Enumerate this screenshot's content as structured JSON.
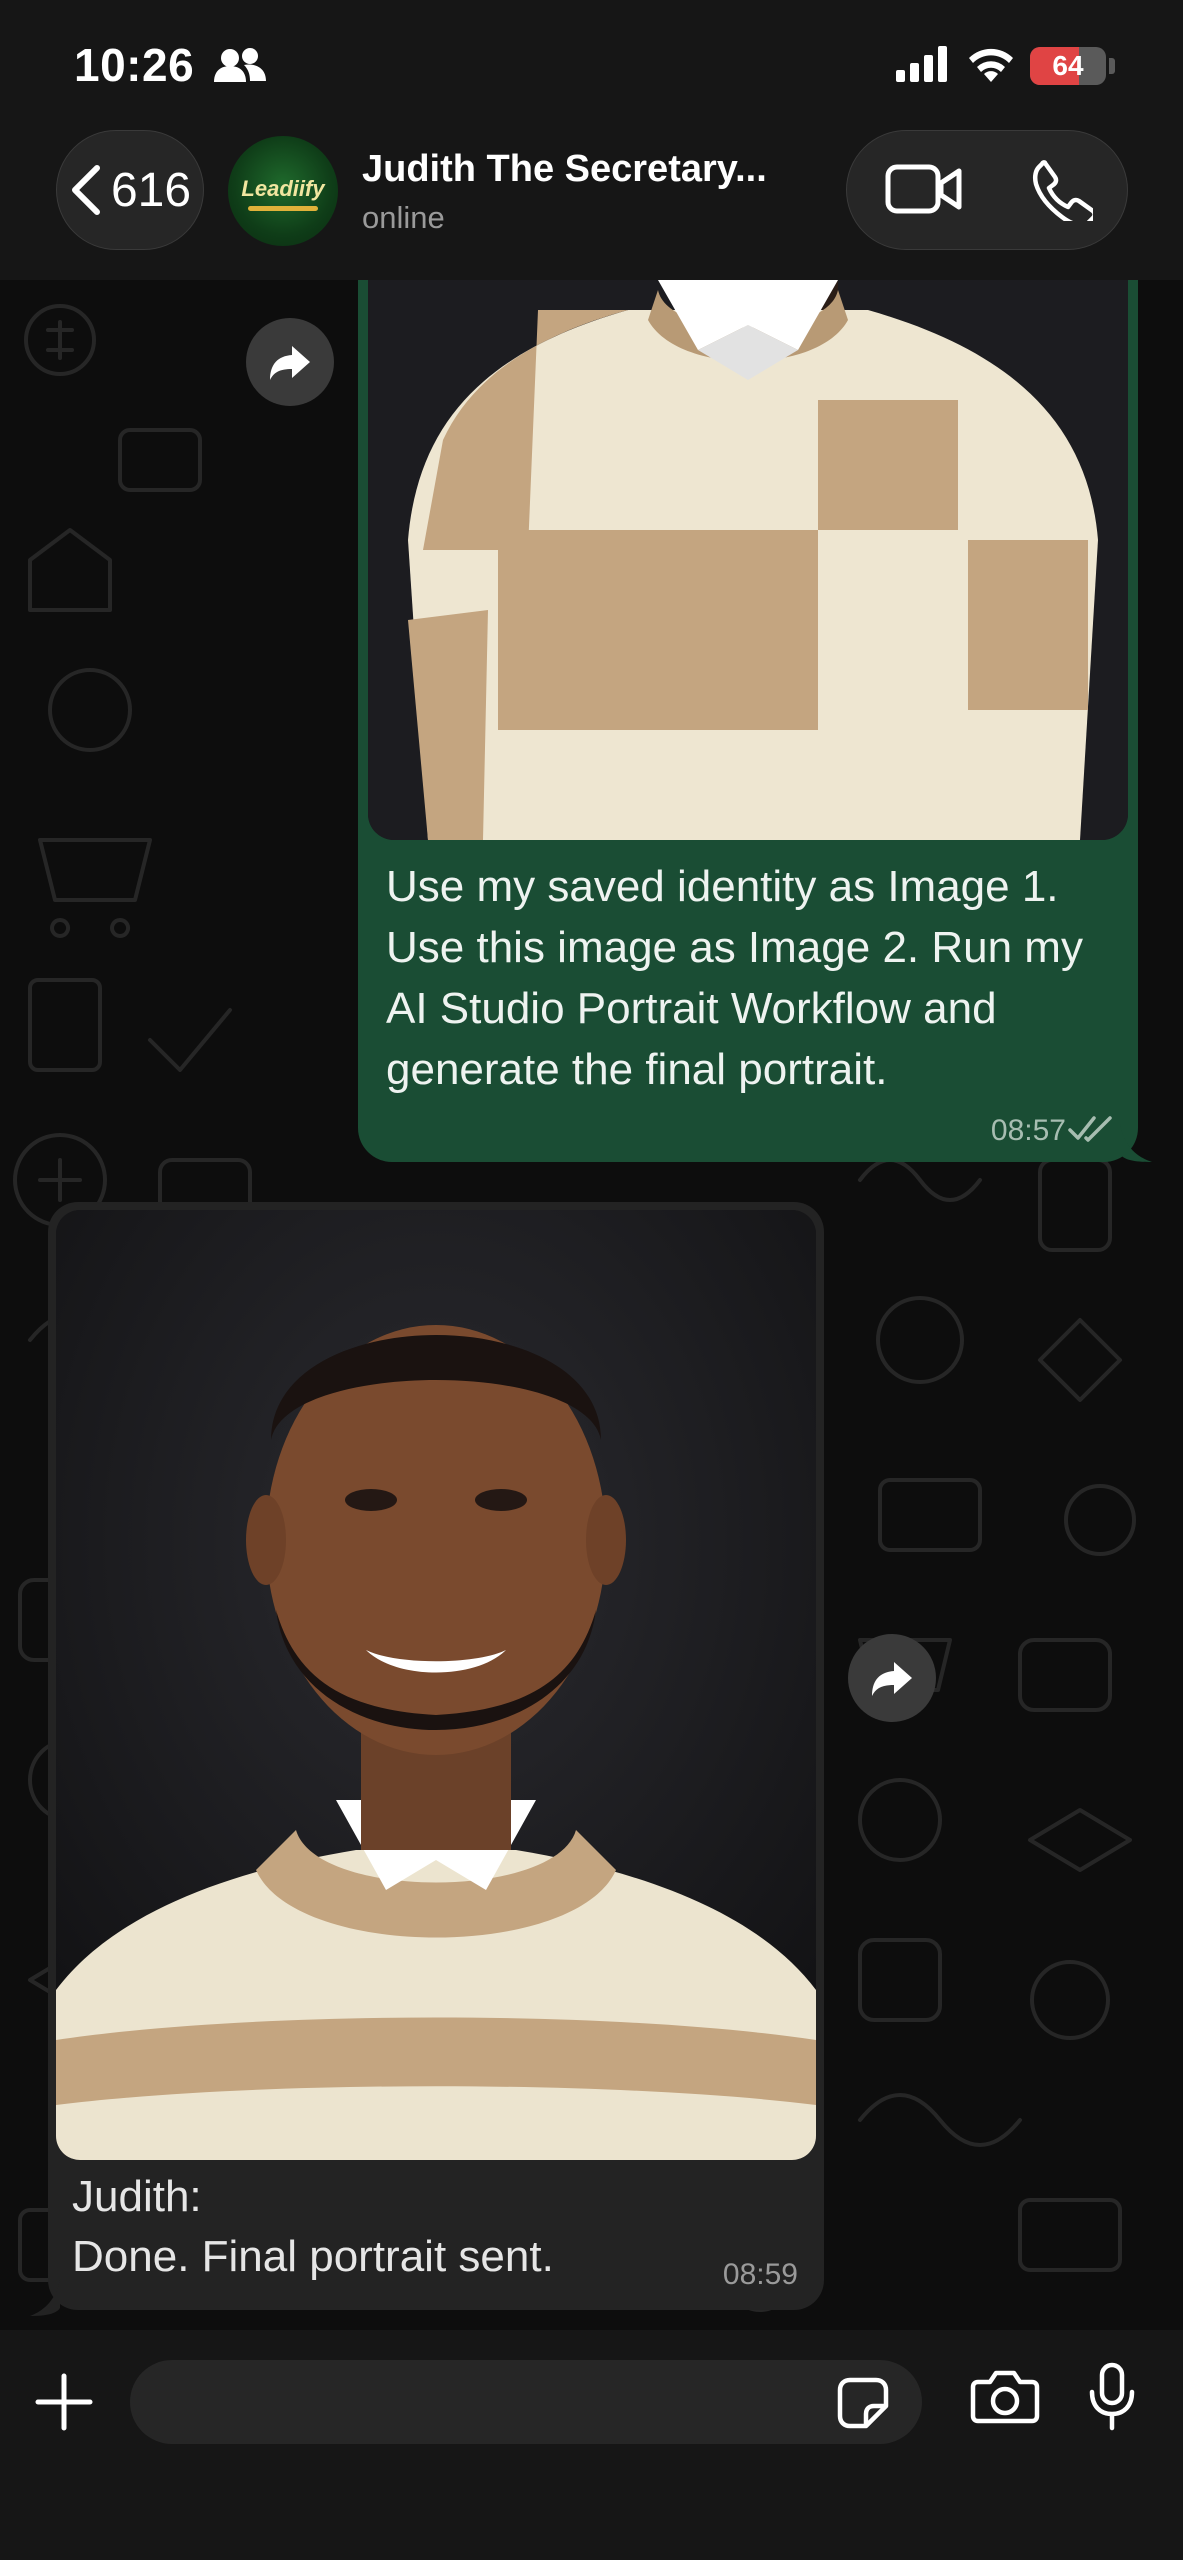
{
  "status_bar": {
    "time": "10:26",
    "battery_level": "64",
    "battery_fraction": 0.64,
    "icons": [
      "people-icon",
      "cellular-signal-icon",
      "wifi-icon",
      "battery-icon"
    ]
  },
  "header": {
    "back_count": "616",
    "avatar_text": "Leadiify",
    "contact_name": "Judith The Secretary...",
    "contact_status": "online",
    "icons": [
      "chevron-left-icon",
      "video-call-icon",
      "phone-call-icon"
    ]
  },
  "messages": {
    "outgoing": {
      "text": "Use my saved identity as Image 1. Use this image as Image 2. Run my AI Studio Portrait Workflow and generate the final portrait.",
      "time": "08:57",
      "status": "read"
    },
    "incoming": {
      "sender": "Judith:",
      "text": "Done. Final portrait sent.",
      "time": "08:59"
    }
  },
  "composer": {
    "icons": [
      "plus-icon",
      "sticker-icon",
      "camera-icon",
      "microphone-icon"
    ]
  },
  "colors": {
    "outgoing_bubble": "#1a4d34",
    "incoming_bubble": "#232323",
    "bar_background": "#161616",
    "battery_red": "#e04444"
  }
}
